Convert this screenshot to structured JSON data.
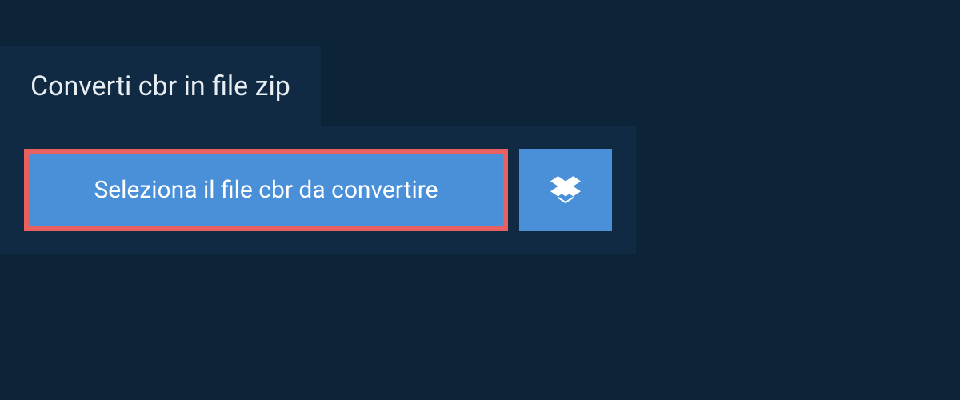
{
  "header": {
    "title": "Converti cbr in file zip"
  },
  "actions": {
    "select_file_label": "Seleziona il file cbr da convertire",
    "dropbox_icon_name": "dropbox"
  },
  "colors": {
    "background": "#0d2438",
    "panel": "#102a43",
    "button_primary": "#4a90d9",
    "button_border_highlight": "#e86160",
    "text_light": "#ffffff"
  }
}
